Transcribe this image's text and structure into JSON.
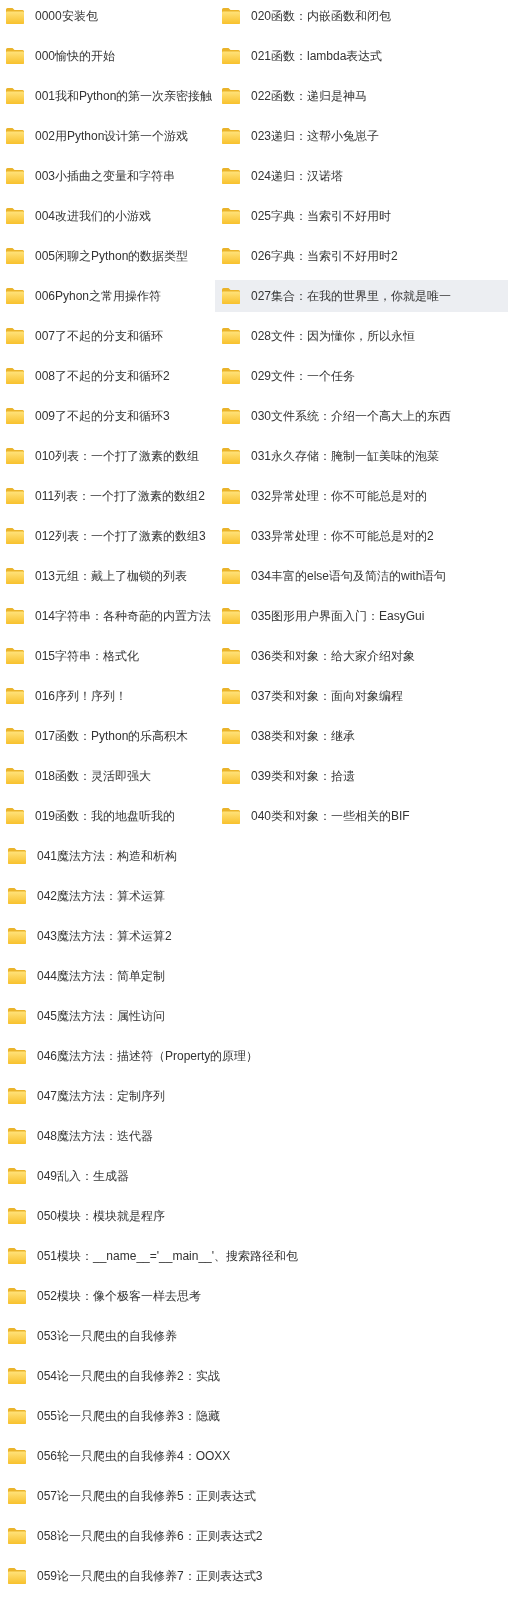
{
  "columns": [
    [
      {
        "name": "0000安装包",
        "selected": false
      },
      {
        "name": "000愉快的开始",
        "selected": false
      },
      {
        "name": "001我和Python的第一次亲密接触",
        "selected": false
      },
      {
        "name": "002用Python设计第一个游戏",
        "selected": false
      },
      {
        "name": "003小插曲之变量和字符串",
        "selected": false
      },
      {
        "name": "004改进我们的小游戏",
        "selected": false
      },
      {
        "name": "005闲聊之Python的数据类型",
        "selected": false
      },
      {
        "name": "006Pyhon之常用操作符",
        "selected": false
      },
      {
        "name": "007了不起的分支和循环",
        "selected": false
      },
      {
        "name": "008了不起的分支和循环2",
        "selected": false
      },
      {
        "name": "009了不起的分支和循环3",
        "selected": false
      },
      {
        "name": "010列表：一个打了激素的数组",
        "selected": false
      },
      {
        "name": "011列表：一个打了激素的数组2",
        "selected": false
      },
      {
        "name": "012列表：一个打了激素的数组3",
        "selected": false
      },
      {
        "name": "013元组：戴上了枷锁的列表",
        "selected": false
      },
      {
        "name": "014字符串：各种奇葩的内置方法",
        "selected": false
      },
      {
        "name": "015字符串：格式化",
        "selected": false
      },
      {
        "name": "016序列！序列！",
        "selected": false
      },
      {
        "name": "017函数：Python的乐高积木",
        "selected": false
      },
      {
        "name": "018函数：灵活即强大",
        "selected": false
      },
      {
        "name": "019函数：我的地盘听我的",
        "selected": false
      }
    ],
    [
      {
        "name": "020函数：内嵌函数和闭包",
        "selected": false
      },
      {
        "name": "021函数：lambda表达式",
        "selected": false
      },
      {
        "name": "022函数：递归是神马",
        "selected": false
      },
      {
        "name": "023递归：这帮小兔崽子",
        "selected": false
      },
      {
        "name": "024递归：汉诺塔",
        "selected": false
      },
      {
        "name": "025字典：当索引不好用时",
        "selected": false
      },
      {
        "name": "026字典：当索引不好用时2",
        "selected": false
      },
      {
        "name": "027集合：在我的世界里，你就是唯一",
        "selected": true
      },
      {
        "name": "028文件：因为懂你，所以永恒",
        "selected": false
      },
      {
        "name": "029文件：一个任务",
        "selected": false
      },
      {
        "name": "030文件系统：介绍一个高大上的东西",
        "selected": false
      },
      {
        "name": "031永久存储：腌制一缸美味的泡菜",
        "selected": false
      },
      {
        "name": "032异常处理：你不可能总是对的",
        "selected": false
      },
      {
        "name": "033异常处理：你不可能总是对的2",
        "selected": false
      },
      {
        "name": "034丰富的else语句及简洁的with语句",
        "selected": false
      },
      {
        "name": "035图形用户界面入门：EasyGui",
        "selected": false
      },
      {
        "name": "036类和对象：给大家介绍对象",
        "selected": false
      },
      {
        "name": "037类和对象：面向对象编程",
        "selected": false
      },
      {
        "name": "038类和对象：继承",
        "selected": false
      },
      {
        "name": "039类和对象：拾遗",
        "selected": false
      },
      {
        "name": "040类和对象：一些相关的BIF",
        "selected": false
      }
    ]
  ],
  "more_folders": [
    {
      "name": "041魔法方法：构造和析构",
      "selected": false
    },
    {
      "name": "042魔法方法：算术运算",
      "selected": false
    },
    {
      "name": "043魔法方法：算术运算2",
      "selected": false
    },
    {
      "name": "044魔法方法：简单定制",
      "selected": false
    },
    {
      "name": "045魔法方法：属性访问",
      "selected": false
    },
    {
      "name": "046魔法方法：描述符（Property的原理）",
      "selected": false
    },
    {
      "name": "047魔法方法：定制序列",
      "selected": false
    },
    {
      "name": "048魔法方法：迭代器",
      "selected": false
    },
    {
      "name": "049乱入：生成器",
      "selected": false
    },
    {
      "name": "050模块：模块就是程序",
      "selected": false
    },
    {
      "name": "051模块：__name__='__main__'、搜索路径和包",
      "selected": false
    },
    {
      "name": "052模块：像个极客一样去思考",
      "selected": false
    },
    {
      "name": "053论一只爬虫的自我修养",
      "selected": false
    },
    {
      "name": "054论一只爬虫的自我修养2：实战",
      "selected": false
    },
    {
      "name": "055论一只爬虫的自我修养3：隐藏",
      "selected": false
    },
    {
      "name": "056轮一只爬虫的自我修养4：OOXX",
      "selected": false
    },
    {
      "name": "057论一只爬虫的自我修养5：正则表达式",
      "selected": false
    },
    {
      "name": "058论一只爬虫的自我修养6：正则表达式2",
      "selected": false
    },
    {
      "name": "059论一只爬虫的自我修养7：正则表达式3",
      "selected": false
    }
  ]
}
